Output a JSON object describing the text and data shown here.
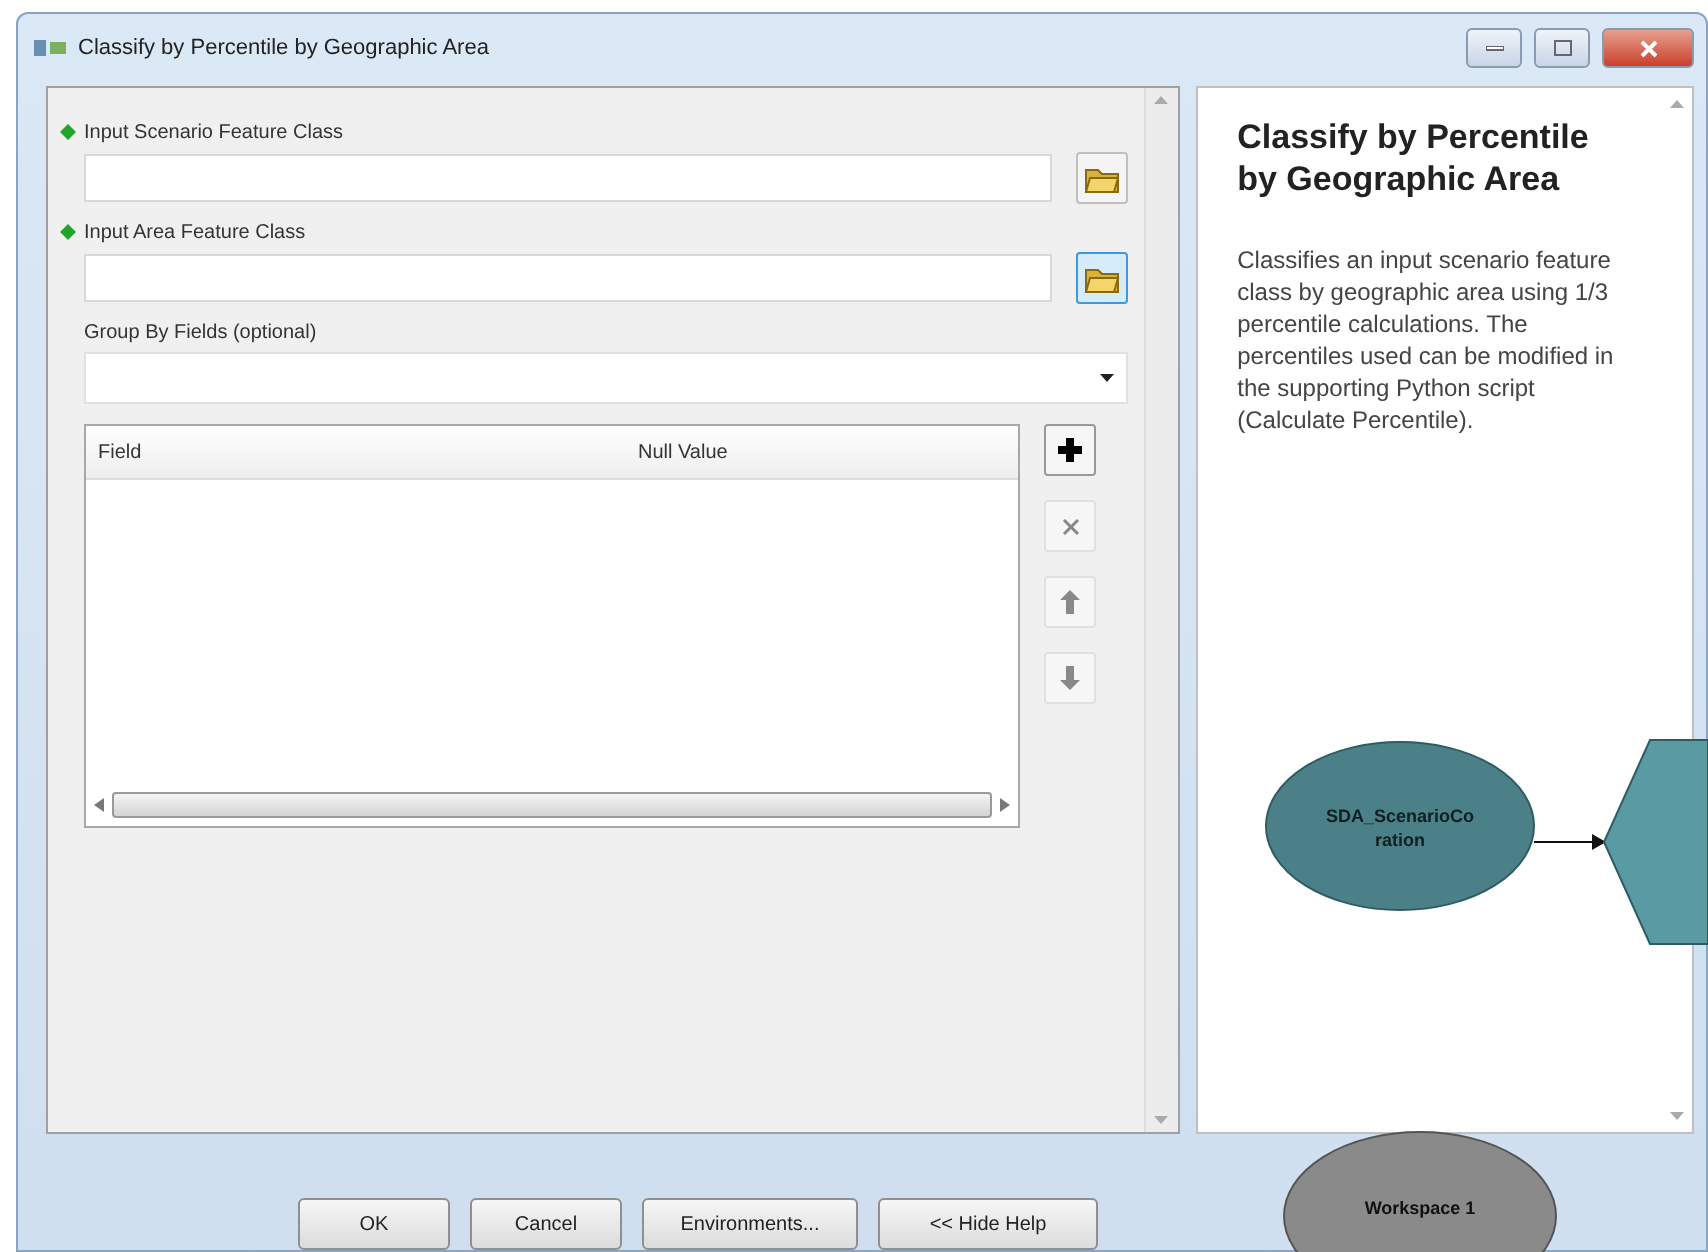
{
  "window": {
    "title": "Classify by Percentile by Geographic Area"
  },
  "parameters": [
    {
      "kind": "dataset",
      "label": "Input Scenario Feature Class",
      "required": true,
      "focused": false
    },
    {
      "kind": "dataset",
      "label": "Input Area Feature Class",
      "required": true,
      "focused": true
    },
    {
      "kind": "dropdown",
      "label": "Group By Fields (optional)",
      "required": false
    }
  ],
  "table": {
    "columns": [
      "Field",
      "Null Value"
    ]
  },
  "help": {
    "title": "Classify by Percentile by Geographic Area",
    "body": "Classifies an input scenario feature class by geographic area using 1/3 percentile calculations. The percentiles used can be modified in the supporting Python script (Calculate Percentile)."
  },
  "buttons": [
    "OK",
    "Cancel",
    "Environments...",
    "<< Hide Help"
  ],
  "diagram": {
    "nodes": [
      {
        "kind": "data",
        "lines": [
          "SDA_ScenarioCo",
          "ration"
        ]
      },
      {
        "kind": "tool"
      },
      {
        "kind": "variable",
        "lines": [
          "Workspace 1"
        ]
      }
    ]
  }
}
